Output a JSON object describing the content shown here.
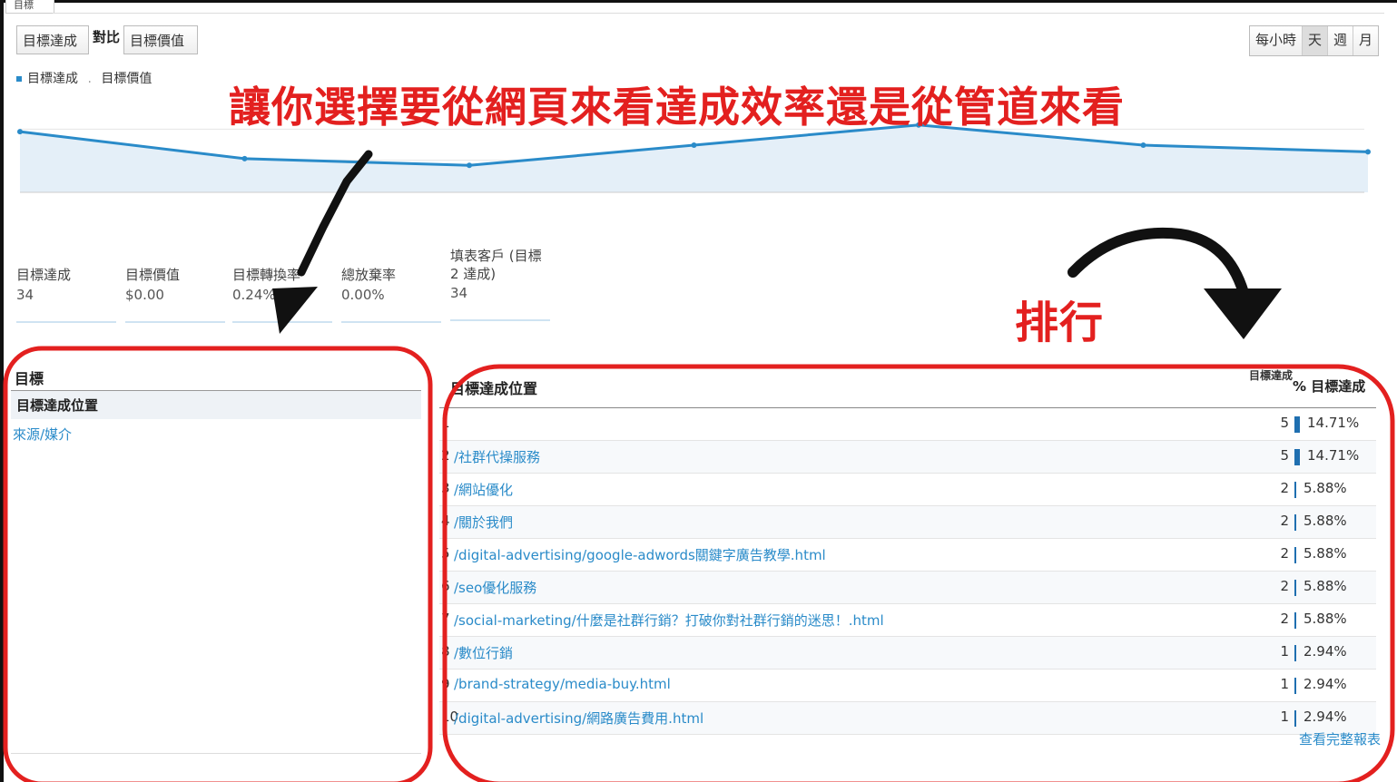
{
  "tab": "目標",
  "controls": {
    "metric_a": "目標達成",
    "vs": "對比",
    "metric_b": "目標價值",
    "granularity": [
      "每小時",
      "天",
      "週",
      "月"
    ],
    "granularity_active": "天"
  },
  "legend": {
    "series_a": "目標達成",
    "series_b": "目標價值"
  },
  "annotations": {
    "top": "讓你選擇要從網頁來看達成效率還是從管道來看",
    "right": "排行"
  },
  "chart_data": {
    "type": "area",
    "x": [
      0,
      1,
      2,
      3,
      4,
      5,
      6
    ],
    "series": [
      {
        "values": [
          9,
          5,
          4,
          7,
          10,
          7,
          6
        ]
      }
    ],
    "ylim": [
      0,
      14
    ],
    "grid": true
  },
  "metrics": [
    {
      "label": "目標達成",
      "value": "34"
    },
    {
      "label": "目標價值",
      "value": "$0.00"
    },
    {
      "label": "目標轉換率",
      "value": "0.24%"
    },
    {
      "label": "總放棄率",
      "value": "0.00%"
    },
    {
      "label": "填表客戶 (目標 2 達成)",
      "value": "34"
    }
  ],
  "left_panel": {
    "header": "目標",
    "selected": "目標達成位置",
    "link": "來源/媒介"
  },
  "table": {
    "col_page": "目標達成位置",
    "col_count": "目標達成",
    "col_pct": "% 目標達成",
    "rows": [
      {
        "idx": "1",
        "page": "",
        "count": "5",
        "pct": "14.71%",
        "frac": 0.1471
      },
      {
        "idx": "2",
        "page": "/社群代操服務",
        "count": "5",
        "pct": "14.71%",
        "frac": 0.1471
      },
      {
        "idx": "3",
        "page": "/網站優化",
        "count": "2",
        "pct": "5.88%",
        "frac": 0.0588
      },
      {
        "idx": "4",
        "page": "/關於我們",
        "count": "2",
        "pct": "5.88%",
        "frac": 0.0588
      },
      {
        "idx": "5",
        "page": "/digital-advertising/google-adwords關鍵字廣告教學.html",
        "count": "2",
        "pct": "5.88%",
        "frac": 0.0588
      },
      {
        "idx": "6",
        "page": "/seo優化服務",
        "count": "2",
        "pct": "5.88%",
        "frac": 0.0588
      },
      {
        "idx": "7",
        "page": "/social-marketing/什麼是社群行銷？打破你對社群行銷的迷思！.html",
        "count": "2",
        "pct": "5.88%",
        "frac": 0.0588
      },
      {
        "idx": "8",
        "page": "/數位行銷",
        "count": "1",
        "pct": "2.94%",
        "frac": 0.0294
      },
      {
        "idx": "9",
        "page": "/brand-strategy/media-buy.html",
        "count": "1",
        "pct": "2.94%",
        "frac": 0.0294
      },
      {
        "idx": "10",
        "page": "/digital-advertising/網路廣告費用.html",
        "count": "1",
        "pct": "2.94%",
        "frac": 0.0294
      }
    ],
    "more_link": "查看完整報表"
  },
  "colors": {
    "annotation": "#e3201f",
    "series": "#2a8bc9",
    "bar": "#1f6fb0"
  }
}
